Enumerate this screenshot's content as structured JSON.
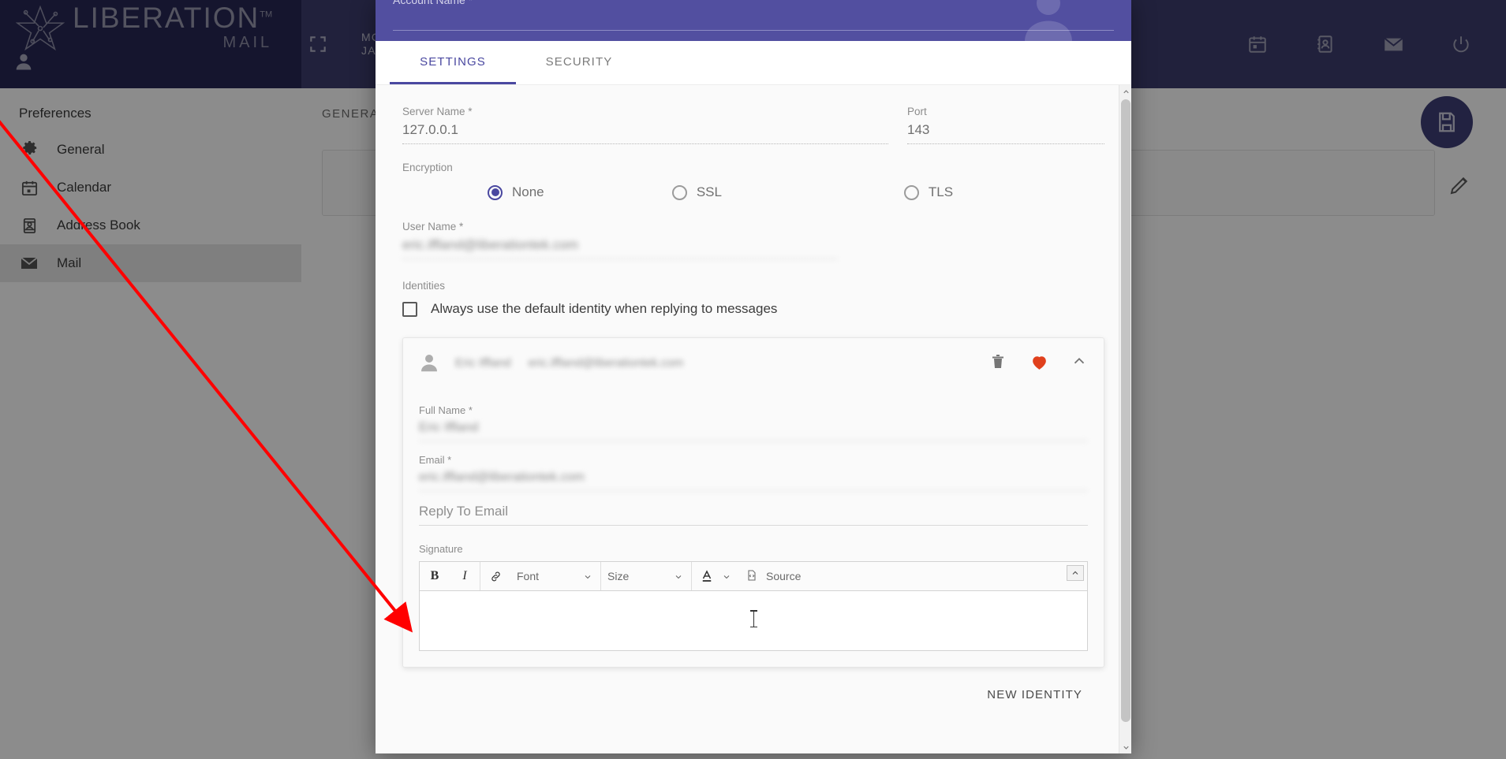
{
  "brand": {
    "name": "LIBERATION",
    "tm": "TM",
    "sub": "MAIL"
  },
  "topbar": {
    "expand_icon": "expand-icon",
    "month": "MONDAY",
    "date": "JANUARY",
    "icons": [
      {
        "name": "calendar-icon",
        "label": "Calendar"
      },
      {
        "name": "address-book-icon",
        "label": "Address Book"
      },
      {
        "name": "mail-icon",
        "label": "Mail"
      },
      {
        "name": "power-icon",
        "label": "Logout"
      }
    ]
  },
  "sidebar": {
    "title": "Preferences",
    "items": [
      {
        "label": "General",
        "icon": "gear-icon",
        "active": false
      },
      {
        "label": "Calendar",
        "icon": "calendar-icon",
        "active": false
      },
      {
        "label": "Address Book",
        "icon": "address-book-icon",
        "active": false
      },
      {
        "label": "Mail",
        "icon": "mail-icon",
        "active": true
      }
    ]
  },
  "content": {
    "heading": "GENERAL",
    "card_text": "",
    "edit_icon": "pencil-icon",
    "fab_icon": "save-icon"
  },
  "modal": {
    "header": {
      "account_name_label": "Account Name *",
      "account_name_value": "",
      "avatar_icon": "person-icon"
    },
    "tabs": [
      {
        "label": "SETTINGS",
        "active": true
      },
      {
        "label": "SECURITY",
        "active": false
      }
    ],
    "settings": {
      "server_name_label": "Server Name *",
      "server_name_value": "127.0.0.1",
      "port_label": "Port",
      "port_value": "143",
      "encryption_label": "Encryption",
      "encryption_options": [
        {
          "label": "None",
          "selected": true
        },
        {
          "label": "SSL",
          "selected": false
        },
        {
          "label": "TLS",
          "selected": false
        }
      ],
      "user_name_label": "User Name *",
      "user_name_value": "eric.iffland@liberationtek.com",
      "identities_label": "Identities",
      "default_identity_checkbox": {
        "label": "Always use the default identity when replying to messages",
        "checked": false
      },
      "identity_card": {
        "avatar_icon": "person-icon",
        "display_name": "Eric Iffland",
        "display_email": "eric.iffland@liberationtek.com",
        "actions": [
          {
            "name": "delete-icon",
            "label": "Delete"
          },
          {
            "name": "heart-icon",
            "label": "Default identity",
            "color": "#e0401c"
          },
          {
            "name": "chevron-up-icon",
            "label": "Collapse"
          }
        ],
        "full_name_label": "Full Name *",
        "full_name_value": "Eric Iffland",
        "email_label": "Email *",
        "email_value": "eric.iffland@liberationtek.com",
        "reply_to_label": "Reply To Email",
        "reply_to_value": "",
        "reply_to_placeholder": "Reply To Email",
        "signature_label": "Signature",
        "signature_value": "",
        "toolbar": {
          "bold": "B",
          "italic": "I",
          "link_icon": "link-icon",
          "font_select": "Font",
          "size_select": "Size",
          "text_color_icon": "text-color-icon",
          "source_icon": "source-icon",
          "source_label": "Source",
          "collapse_icon": "toolbar-collapse-icon"
        }
      },
      "new_identity_label": "NEW IDENTITY"
    },
    "scrollbar": {
      "up_icon": "chevron-up-icon",
      "down_icon": "chevron-down-icon"
    }
  },
  "colors": {
    "brand_dark": "#272755",
    "brand_top": "#3c3c6e",
    "accent": "#4a48a0",
    "modal_header": "#524fa0",
    "heart": "#e0401c",
    "annotation": "#ff0000"
  }
}
